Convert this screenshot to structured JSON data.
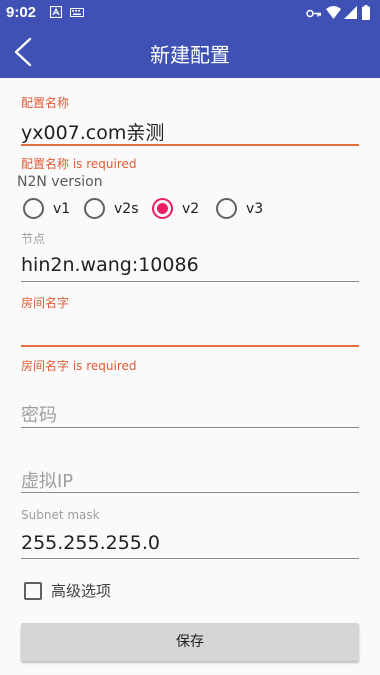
{
  "status_bar": {
    "time": "9:02",
    "icons": [
      "a-icon",
      "keyboard-icon",
      "key-icon",
      "wifi-icon",
      "signal-icon",
      "battery-icon"
    ]
  },
  "app_bar": {
    "title": "新建配置",
    "back_icon": "chevron-left-icon",
    "background_color": "#3f51b5"
  },
  "form": {
    "config_name": {
      "label": "配置名称",
      "value": "yx007.com亲测",
      "error": "配置名称 is required"
    },
    "n2n_version": {
      "label": "N2N version",
      "options": [
        "v1",
        "v2s",
        "v2",
        "v3"
      ],
      "selected": "v2"
    },
    "node": {
      "label": "节点",
      "value": "hin2n.wang:10086"
    },
    "room_name": {
      "label": "房间名字",
      "value": "",
      "error": "房间名字 is required"
    },
    "password": {
      "placeholder": "密码"
    },
    "virtual_ip": {
      "placeholder": "虚拟IP"
    },
    "subnet_mask": {
      "label": "Subnet mask",
      "value": "255.255.255.0"
    },
    "advanced_options": {
      "label": "高级选项",
      "checked": false
    },
    "save_button": {
      "label": "保存"
    }
  },
  "colors": {
    "primary": "#3f51b5",
    "error": "#e25a35",
    "accent": "#e91e63"
  }
}
